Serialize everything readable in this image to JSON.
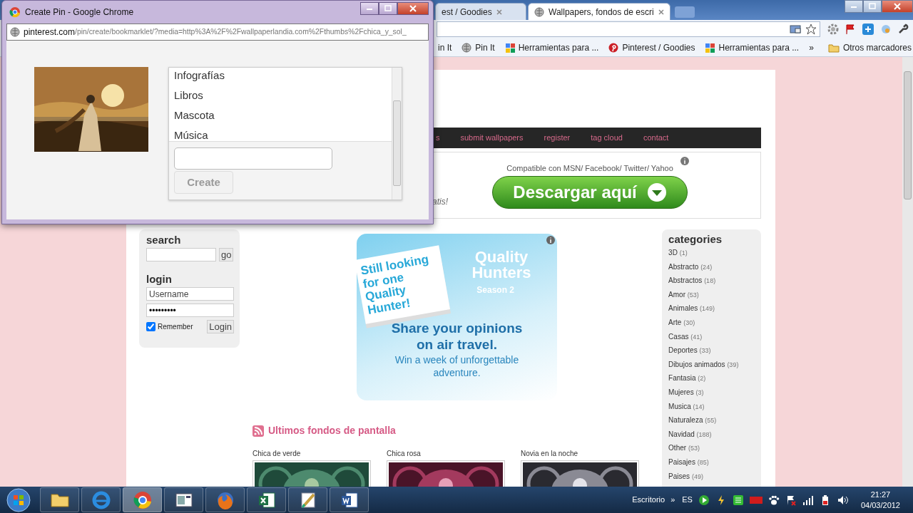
{
  "browser": {
    "tabs": [
      {
        "label": "est / Goodies",
        "selected": false
      },
      {
        "label": "Wallpapers, fondos de escri",
        "selected": true
      }
    ],
    "bookmarks": [
      {
        "label": "in It",
        "kind": "plain"
      },
      {
        "label": "Pin It",
        "kind": "globe"
      },
      {
        "label": "Herramientas para ...",
        "kind": "tiles"
      },
      {
        "label": "Pinterest / Goodies",
        "kind": "pin"
      },
      {
        "label": "Herramientas para ...",
        "kind": "tiles"
      }
    ],
    "more": "»",
    "other_bookmarks": "Otros marcadores"
  },
  "page": {
    "nav_links": [
      "s",
      "submit wallpapers",
      "register",
      "tag cloud",
      "contact"
    ],
    "promo": {
      "partial": "atis!",
      "note": "Compatible con MSN/ Facebook/ Twitter/ Yahoo",
      "button": "Descargar aquí"
    },
    "search": {
      "title": "search",
      "button": "go"
    },
    "login": {
      "title": "login",
      "username": "Username",
      "password": "•••••••••",
      "remember": {
        "label": "Remember",
        "checked": true
      },
      "button": "Login"
    },
    "banner": {
      "card": "Still looking for one Quality Hunter!",
      "title": "Quality Hunters",
      "season": "Season 2",
      "headline": "Share your opinions on air travel.",
      "sub": "Win a week of unforgettable adventure."
    },
    "latest": {
      "title": "Ultimos fondos de pantalla",
      "items": [
        {
          "caption": "Chica de verde",
          "kind": "picture"
        },
        {
          "caption": "Chica rosa",
          "kind": "picture"
        },
        {
          "caption": "Novia en la noche",
          "kind": "picture"
        }
      ]
    },
    "categories": {
      "title": "categories",
      "items": [
        {
          "name": "3D",
          "count": "(1)"
        },
        {
          "name": "Abstracto",
          "count": "(24)"
        },
        {
          "name": "Abstractos",
          "count": "(18)"
        },
        {
          "name": "Amor",
          "count": "(53)"
        },
        {
          "name": "Animales",
          "count": "(149)"
        },
        {
          "name": "Arte",
          "count": "(30)"
        },
        {
          "name": "Casas",
          "count": "(41)"
        },
        {
          "name": "Deportes",
          "count": "(33)"
        },
        {
          "name": "Dibujos animados",
          "count": "(39)"
        },
        {
          "name": "Fantasia",
          "count": "(2)"
        },
        {
          "name": "Mujeres",
          "count": "(3)"
        },
        {
          "name": "Musica",
          "count": "(14)"
        },
        {
          "name": "Naturaleza",
          "count": "(55)"
        },
        {
          "name": "Navidad",
          "count": "(188)"
        },
        {
          "name": "Other",
          "count": "(53)"
        },
        {
          "name": "Paisajes",
          "count": "(85)"
        },
        {
          "name": "Paises",
          "count": "(49)"
        }
      ]
    }
  },
  "popup": {
    "title": "Create Pin - Google Chrome",
    "url_domain": "pinterest.com",
    "url_path": "/pin/create/bookmarklet/?media=http%3A%2F%2Fwallpaperlandia.com%2Fthumbs%2Fchica_y_sol_",
    "boards": [
      {
        "label": "Infografías",
        "selected": false
      },
      {
        "label": "Libros",
        "selected": false
      },
      {
        "label": "Mascota",
        "selected": false
      },
      {
        "label": "Música",
        "selected": false
      }
    ],
    "create": {
      "label": "Create",
      "disabled": true
    }
  },
  "taskbar": {
    "apps": [
      {
        "kind": "folder",
        "selected": false
      },
      {
        "kind": "ie",
        "selected": false
      },
      {
        "kind": "chrome",
        "selected": true
      },
      {
        "kind": "window",
        "selected": false
      },
      {
        "kind": "firefox",
        "selected": false
      },
      {
        "kind": "excel",
        "selected": false
      },
      {
        "kind": "paint",
        "selected": false
      },
      {
        "kind": "word",
        "selected": false
      }
    ],
    "toolbar": "Escritorio",
    "chevron": "»",
    "language": "ES",
    "time": "21:27",
    "date": "04/03/2012"
  }
}
